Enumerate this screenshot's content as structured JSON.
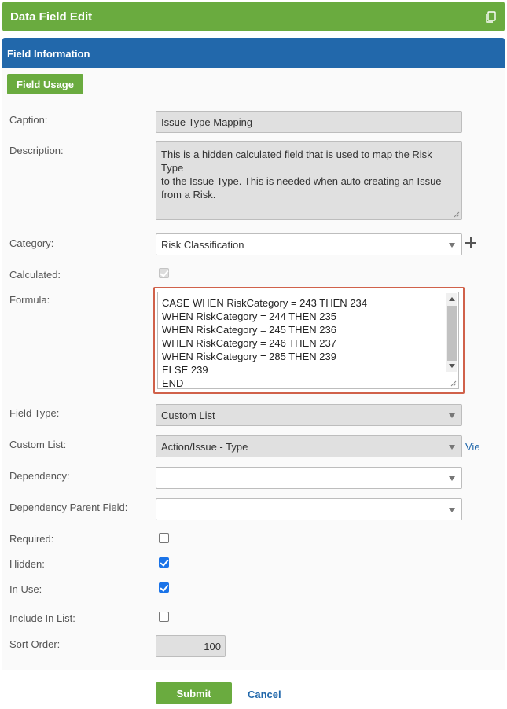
{
  "window": {
    "title": "Data Field Edit"
  },
  "section": {
    "title": "Field Information"
  },
  "field_usage_button": "Field Usage",
  "labels": {
    "caption": "Caption:",
    "description": "Description:",
    "category": "Category:",
    "calculated": "Calculated:",
    "formula": "Formula:",
    "field_type": "Field Type:",
    "custom_list": "Custom List:",
    "dependency": "Dependency:",
    "dependency_parent": "Dependency Parent Field:",
    "required": "Required:",
    "hidden": "Hidden:",
    "in_use": "In Use:",
    "include_in_list": "Include In List:",
    "sort_order": "Sort Order:"
  },
  "values": {
    "caption": "Issue Type Mapping",
    "description_lines": [
      "This is a hidden calculated field that is used to map the Risk Type",
      "to the Issue Type.  This is needed when auto creating an Issue",
      "from a Risk."
    ],
    "category": "Risk Classification",
    "calculated": true,
    "formula_lines": [
      "CASE WHEN RiskCategory = 243 THEN 234",
      "WHEN RiskCategory = 244 THEN 235",
      "WHEN RiskCategory = 245 THEN 236",
      "WHEN RiskCategory = 246 THEN 237",
      "WHEN RiskCategory = 285 THEN 239",
      "ELSE 239",
      "END"
    ],
    "field_type": "Custom List",
    "custom_list": "Action/Issue - Type",
    "custom_list_view_link": "Vie",
    "dependency": "",
    "dependency_parent": "",
    "required": false,
    "hidden": true,
    "in_use": true,
    "include_in_list": false,
    "sort_order": "100"
  },
  "footer": {
    "submit": "Submit",
    "cancel": "Cancel"
  },
  "colors": {
    "green": "#6aab3f",
    "blue": "#2268ab",
    "highlight": "#d0614a"
  }
}
